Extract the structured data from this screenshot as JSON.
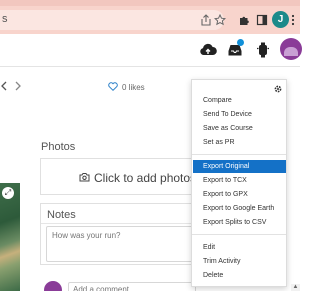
{
  "browser": {
    "omnibox_text": "s",
    "profile_initial": "J",
    "accent": "#f8d4cc"
  },
  "header": {
    "notification_color": "#1190d9"
  },
  "activity": {
    "likes_text": "0 likes",
    "photos_title": "Photos",
    "photos_cta": "Click to add photos to",
    "notes_title": "Notes",
    "notes_placeholder": "How was your run?",
    "comment_placeholder": "Add a comment"
  },
  "menu": {
    "items": [
      {
        "label": "Compare"
      },
      {
        "label": "Send To Device"
      },
      {
        "label": "Save as Course"
      },
      {
        "label": "Set as PR"
      },
      {
        "label": "Export Original",
        "active": true
      },
      {
        "label": "Export to TCX"
      },
      {
        "label": "Export to GPX"
      },
      {
        "label": "Export to Google Earth"
      },
      {
        "label": "Export Splits to CSV"
      },
      {
        "label": "Edit"
      },
      {
        "label": "Trim Activity"
      },
      {
        "label": "Delete"
      }
    ],
    "active_color": "#1471c7"
  }
}
